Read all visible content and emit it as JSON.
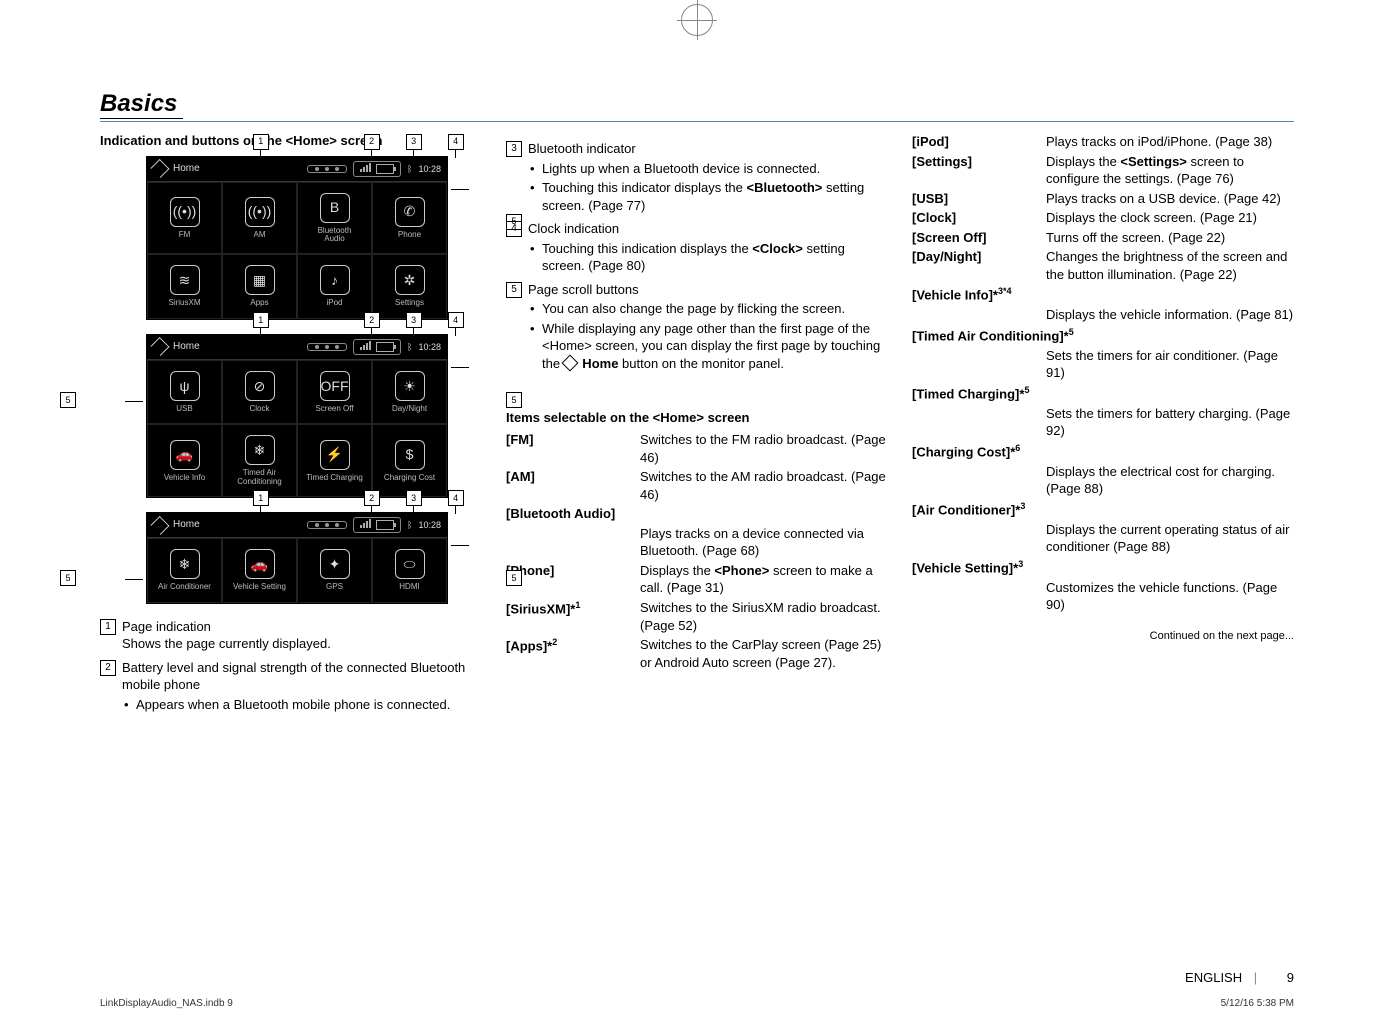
{
  "section_title": "Basics",
  "col1": {
    "heading": "Indication and buttons on the <Home> screen",
    "home_label": "Home",
    "clock": "10:28",
    "screens": [
      {
        "icons": [
          {
            "glyph": "((•))",
            "label": "FM"
          },
          {
            "glyph": "((•))",
            "label": "AM"
          },
          {
            "glyph": "B",
            "label": "Bluetooth\nAudio"
          },
          {
            "glyph": "✆",
            "label": "Phone"
          },
          {
            "glyph": "≋",
            "label": "SiriusXM"
          },
          {
            "glyph": "▦",
            "label": "Apps"
          },
          {
            "glyph": "♪",
            "label": "iPod"
          },
          {
            "glyph": "✲",
            "label": "Settings"
          }
        ]
      },
      {
        "icons": [
          {
            "glyph": "ψ",
            "label": "USB"
          },
          {
            "glyph": "⊘",
            "label": "Clock"
          },
          {
            "glyph": "OFF",
            "label": "Screen Off"
          },
          {
            "glyph": "☀",
            "label": "Day/Night"
          },
          {
            "glyph": "🚗",
            "label": "Vehicle Info"
          },
          {
            "glyph": "❄",
            "label": "Timed Air\nConditioning"
          },
          {
            "glyph": "⚡",
            "label": "Timed Charging"
          },
          {
            "glyph": "$",
            "label": "Charging Cost"
          }
        ]
      },
      {
        "icons": [
          {
            "glyph": "❄",
            "label": "Air Conditioner"
          },
          {
            "glyph": "🚗",
            "label": "Vehicle Setting"
          },
          {
            "glyph": "✦",
            "label": "GPS"
          },
          {
            "glyph": "⬭",
            "label": "HDMI"
          }
        ],
        "rows": 1
      }
    ],
    "callouts": {
      "1": "1",
      "2": "2",
      "3": "3",
      "4": "4",
      "5": "5"
    },
    "list": [
      {
        "n": "1",
        "title": "Page indication",
        "body": "Shows the page currently displayed."
      },
      {
        "n": "2",
        "title": "Battery level and signal strength of the connected Bluetooth mobile phone",
        "bullets": [
          "Appears when a Bluetooth mobile phone is connected."
        ]
      }
    ]
  },
  "col2": {
    "list": [
      {
        "n": "3",
        "title": "Bluetooth indicator",
        "bullets": [
          "Lights up when a Bluetooth device is connected.",
          "Touching this indicator displays the <Bluetooth> setting screen. (Page 77)"
        ]
      },
      {
        "n": "4",
        "title": "Clock indication",
        "bullets": [
          "Touching this indication displays the <Clock> setting screen. (Page 80)"
        ]
      },
      {
        "n": "5",
        "title": "Page scroll buttons",
        "bullets": [
          "You can also change the page by flicking the screen.",
          "While displaying any page other than the first page of the <Home> screen, you can display the first page by touching the ⌂ Home button on the monitor panel."
        ]
      }
    ],
    "items_heading": "Items selectable on the <Home> screen",
    "items": [
      {
        "k": "[FM]",
        "v": "Switches to the FM radio broadcast. (Page 46)"
      },
      {
        "k": "[AM]",
        "v": "Switches to the AM radio broadcast. (Page 46)"
      },
      {
        "k": "[Bluetooth Audio]",
        "full": true,
        "v": "Plays tracks on a device connected via Bluetooth. (Page 68)"
      },
      {
        "k": "[Phone]",
        "v": "Displays the <Phone> screen to make a call. (Page 31)"
      },
      {
        "k": "[SiriusXM]*",
        "sup": "1",
        "v": "Switches to the SiriusXM radio broadcast. (Page 52)"
      },
      {
        "k": "[Apps]*",
        "sup": "2",
        "v": "Switches to the CarPlay screen (Page 25) or Android Auto screen (Page 27)."
      }
    ]
  },
  "col3": {
    "items": [
      {
        "k": "[iPod]",
        "v": "Plays tracks on iPod/iPhone. (Page 38)"
      },
      {
        "k": "[Settings]",
        "v": "Displays the <Settings> screen to configure the settings. (Page 76)"
      },
      {
        "k": "[USB]",
        "v": "Plays tracks on a USB device. (Page 42)"
      },
      {
        "k": "[Clock]",
        "v": "Displays the clock screen. (Page 21)"
      },
      {
        "k": "[Screen Off]",
        "v": "Turns off the screen. (Page 22)"
      },
      {
        "k": "[Day/Night]",
        "v": "Changes the brightness of the screen and the button illumination. (Page 22)"
      },
      {
        "k": "[Vehicle Info]*",
        "sup": "3*4",
        "full": true,
        "v": "Displays the vehicle information. (Page 81)"
      },
      {
        "k": "[Timed Air Conditioning]*",
        "sup": "5",
        "full": true,
        "v": "Sets the timers for air conditioner. (Page 91)"
      },
      {
        "k": "[Timed Charging]*",
        "sup": "5",
        "full": true,
        "v": "Sets the timers for battery charging. (Page 92)"
      },
      {
        "k": "[Charging Cost]*",
        "sup": "6",
        "full": true,
        "v": "Displays the electrical cost for charging. (Page 88)"
      },
      {
        "k": "[Air Conditioner]*",
        "sup": "3",
        "full": true,
        "v": "Displays the current operating status of air conditioner (Page 88)"
      },
      {
        "k": "[Vehicle Setting]*",
        "sup": "3",
        "full": true,
        "v": "Customizes the vehicle functions. (Page 90)"
      }
    ],
    "continued": "Continued on the next page..."
  },
  "footer": {
    "left": "LinkDisplayAudio_NAS.indb   9",
    "right": "5/12/16   5:38 PM",
    "lang": "ENGLISH",
    "page": "9"
  }
}
